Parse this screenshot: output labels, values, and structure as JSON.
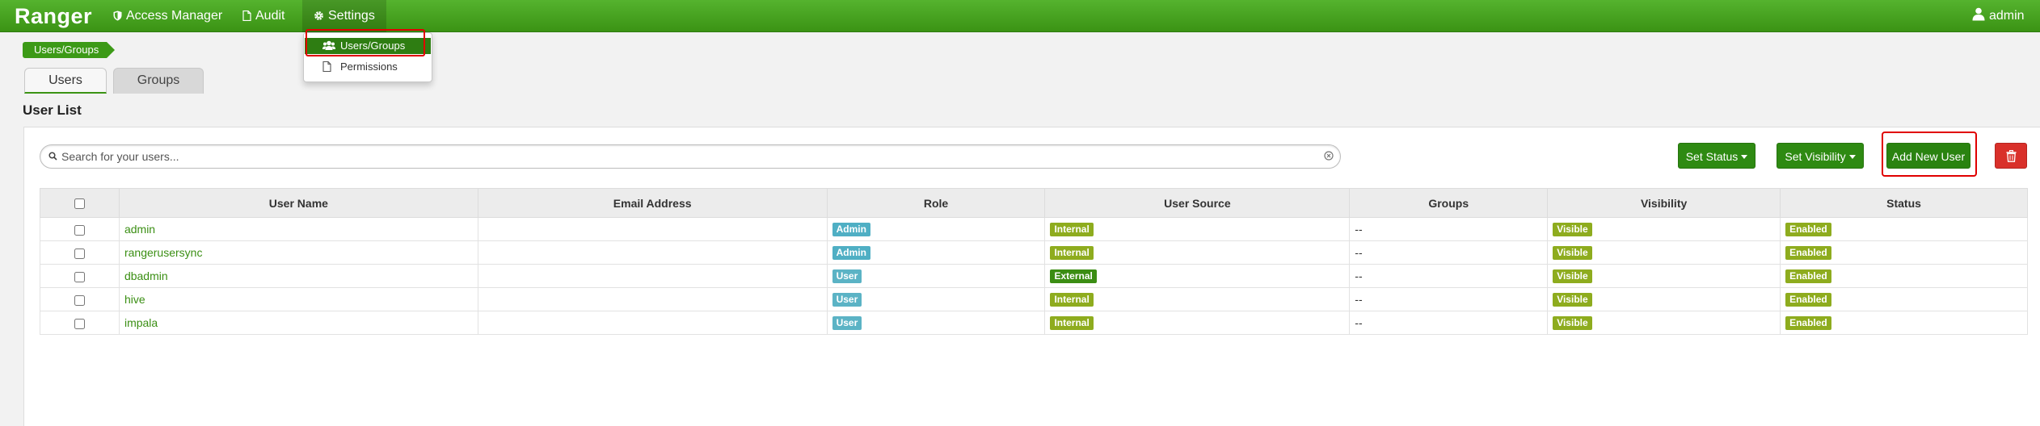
{
  "navbar": {
    "brand": "Ranger",
    "access_manager": "Access Manager",
    "audit": "Audit",
    "settings": "Settings",
    "user": "admin",
    "bg_color": "#45a320"
  },
  "settings_menu": {
    "items": [
      {
        "label": "Users/Groups",
        "icon": "users-icon"
      },
      {
        "label": "Permissions",
        "icon": "file-icon"
      }
    ]
  },
  "breadcrumb": "Users/Groups",
  "tabs": [
    {
      "label": "Users",
      "active": true
    },
    {
      "label": "Groups",
      "active": false
    }
  ],
  "list_title": "User List",
  "search": {
    "placeholder": "Search for your users...",
    "value": ""
  },
  "toolbar": {
    "set_status": "Set Status",
    "set_visibility": "Set Visibility",
    "add_new_user": "Add New User",
    "delete_icon": "trash-icon"
  },
  "table": {
    "columns": [
      "User Name",
      "Email Address",
      "Role",
      "User Source",
      "Groups",
      "Visibility",
      "Status"
    ],
    "rows": [
      {
        "name": "admin",
        "email": "",
        "role": "Admin",
        "source": "Internal",
        "groups": "--",
        "visibility": "Visible",
        "status": "Enabled"
      },
      {
        "name": "rangerusersync",
        "email": "",
        "role": "Admin",
        "source": "Internal",
        "groups": "--",
        "visibility": "Visible",
        "status": "Enabled"
      },
      {
        "name": "dbadmin",
        "email": "",
        "role": "User",
        "source": "External",
        "groups": "--",
        "visibility": "Visible",
        "status": "Enabled"
      },
      {
        "name": "hive",
        "email": "",
        "role": "User",
        "source": "Internal",
        "groups": "--",
        "visibility": "Visible",
        "status": "Enabled"
      },
      {
        "name": "impala",
        "email": "",
        "role": "User",
        "source": "Internal",
        "groups": "--",
        "visibility": "Visible",
        "status": "Enabled"
      }
    ]
  },
  "colors": {
    "accent": "#3b9314",
    "danger": "#d9302a",
    "highlight": "#e00000"
  }
}
